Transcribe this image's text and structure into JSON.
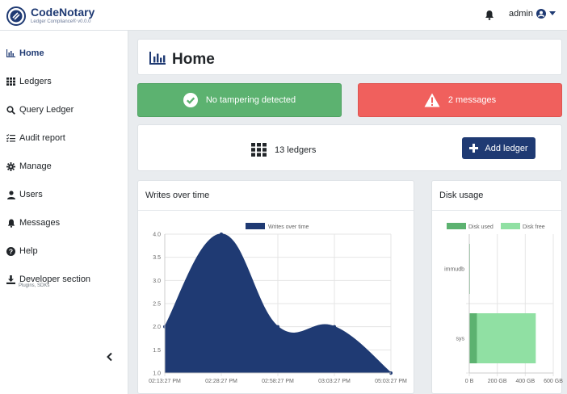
{
  "brand": {
    "title": "CodeNotary",
    "subtitle": "Ledger Compliance® v0.0.0"
  },
  "header": {
    "user": "admin"
  },
  "sidebar": {
    "items": [
      {
        "label": "Home",
        "icon": "bar-chart-icon",
        "active": true
      },
      {
        "label": "Ledgers",
        "icon": "grid-icon"
      },
      {
        "label": "Query Ledger",
        "icon": "search-icon"
      },
      {
        "label": "Audit report",
        "icon": "list-check-icon"
      },
      {
        "label": "Manage",
        "icon": "gear-icon"
      },
      {
        "label": "Users",
        "icon": "user-icon"
      },
      {
        "label": "Messages",
        "icon": "bell-icon"
      },
      {
        "label": "Help",
        "icon": "question-circle-icon"
      },
      {
        "label": "Developer section",
        "icon": "download-icon"
      }
    ],
    "developer_sub": "Plugins, SDKs"
  },
  "page": {
    "title": "Home"
  },
  "alerts": {
    "ok": "No tampering detected",
    "bad": "2 messages"
  },
  "ledgers": {
    "count_label": "13 ledgers",
    "add_label": "Add ledger"
  },
  "colors": {
    "navy": "#1f3a73",
    "green": "#5cb270",
    "red": "#f0605d",
    "disk_used": "#5cb270",
    "disk_free": "#90e0a3"
  },
  "writes": {
    "header": "Writes over time",
    "chart_data": {
      "type": "area",
      "legend": "Writes over time",
      "x": [
        "02:13:27 PM",
        "02:28:27 PM",
        "02:58:27 PM",
        "03:03:27 PM",
        "05:03:27 PM"
      ],
      "x_positions": [
        0,
        1,
        2,
        3,
        4
      ],
      "values": [
        2.0,
        4.0,
        2.0,
        2.0,
        1.0
      ],
      "ylim": [
        1.0,
        4.0
      ],
      "yticks": [
        "1.0",
        "1.5",
        "2.0",
        "2.5",
        "3.0",
        "3.5",
        "4.0"
      ],
      "grid": true
    }
  },
  "disk": {
    "header": "Disk usage",
    "chart_data": {
      "type": "bar",
      "orientation": "horizontal",
      "stacked": true,
      "categories": [
        "immudb",
        "sys"
      ],
      "series": [
        {
          "name": "Disk used",
          "values": [
            5,
            55
          ]
        },
        {
          "name": "Disk free",
          "values": [
            0,
            420
          ]
        }
      ],
      "xticks": [
        "0 B",
        "200 GB",
        "400 GB",
        "600 GB"
      ],
      "xlim": [
        0,
        600
      ],
      "grid": true,
      "legend": "top"
    }
  }
}
